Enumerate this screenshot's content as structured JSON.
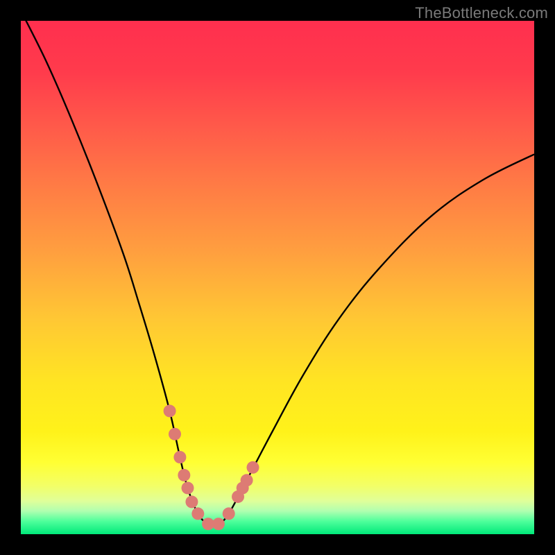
{
  "watermark": "TheBottleneck.com",
  "colors": {
    "background": "#000000",
    "curve": "#000000",
    "marker": "#dd7b74",
    "watermark": "#7a7a7a"
  },
  "gradient_stops": [
    {
      "offset": 0.0,
      "color": "#ff2f4e"
    },
    {
      "offset": 0.1,
      "color": "#ff3b4c"
    },
    {
      "offset": 0.2,
      "color": "#ff584a"
    },
    {
      "offset": 0.32,
      "color": "#ff7b45"
    },
    {
      "offset": 0.45,
      "color": "#ff9f3f"
    },
    {
      "offset": 0.58,
      "color": "#ffc734"
    },
    {
      "offset": 0.7,
      "color": "#ffe423"
    },
    {
      "offset": 0.8,
      "color": "#fff21a"
    },
    {
      "offset": 0.86,
      "color": "#ffff33"
    },
    {
      "offset": 0.905,
      "color": "#f3ff66"
    },
    {
      "offset": 0.935,
      "color": "#e0ff99"
    },
    {
      "offset": 0.955,
      "color": "#b0ffb0"
    },
    {
      "offset": 0.975,
      "color": "#4eff9b"
    },
    {
      "offset": 1.0,
      "color": "#00e97a"
    }
  ],
  "chart_data": {
    "type": "line",
    "title": "",
    "xlabel": "",
    "ylabel": "",
    "xlim": [
      0,
      100
    ],
    "ylim": [
      0,
      100
    ],
    "series": [
      {
        "name": "bottleneck-curve",
        "x": [
          0,
          5,
          10,
          15,
          20,
          23,
          26,
          29,
          31,
          32.5,
          34.5,
          36.5,
          38.5,
          40.5,
          44,
          49,
          55,
          62,
          70,
          80,
          90,
          100
        ],
        "values": [
          102,
          92,
          80.5,
          68,
          54.5,
          45,
          35,
          24,
          15,
          9,
          4,
          2,
          2,
          4,
          10.5,
          20,
          31,
          42,
          52,
          62,
          69,
          74
        ]
      }
    ],
    "markers": [
      {
        "x": 29.0,
        "y": 24.0
      },
      {
        "x": 30.0,
        "y": 19.5
      },
      {
        "x": 31.0,
        "y": 15.0
      },
      {
        "x": 31.8,
        "y": 11.5
      },
      {
        "x": 32.5,
        "y": 9.0
      },
      {
        "x": 33.3,
        "y": 6.3
      },
      {
        "x": 34.5,
        "y": 4.0
      },
      {
        "x": 36.5,
        "y": 2.0
      },
      {
        "x": 38.5,
        "y": 2.0
      },
      {
        "x": 40.5,
        "y": 4.0
      },
      {
        "x": 42.3,
        "y": 7.3
      },
      {
        "x": 43.2,
        "y": 9.0
      },
      {
        "x": 44.0,
        "y": 10.5
      },
      {
        "x": 45.2,
        "y": 13.0
      }
    ]
  }
}
